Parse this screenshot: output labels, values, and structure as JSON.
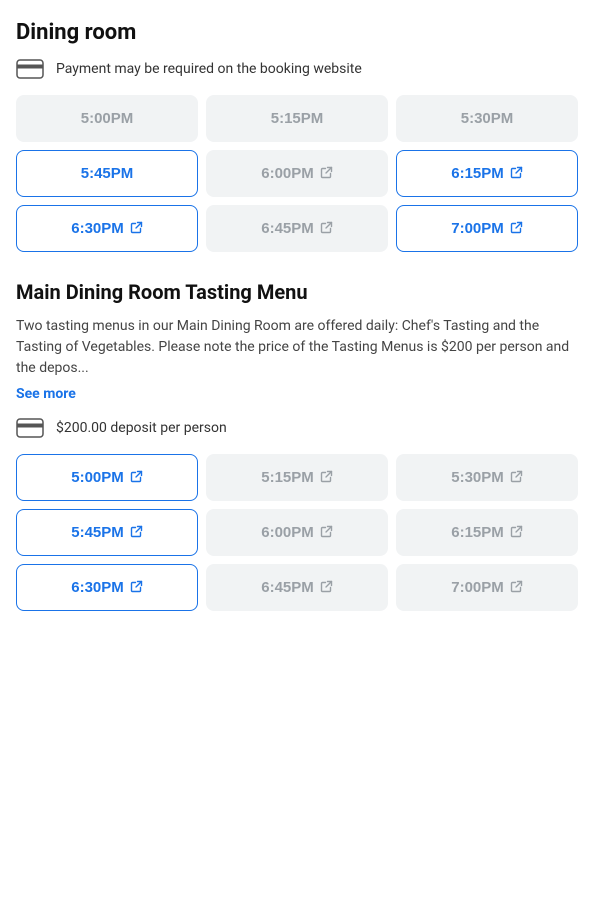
{
  "dining_room": {
    "title": "Dining room",
    "payment_notice": "Payment may be required on the booking website",
    "time_slots_row1": [
      {
        "time": "5:00PM",
        "state": "unavailable",
        "external": false
      },
      {
        "time": "5:15PM",
        "state": "unavailable",
        "external": false
      },
      {
        "time": "5:30PM",
        "state": "unavailable",
        "external": false
      }
    ],
    "time_slots_row2": [
      {
        "time": "5:45PM",
        "state": "active",
        "external": false
      },
      {
        "time": "6:00PM",
        "state": "external-gray",
        "external": true
      },
      {
        "time": "6:15PM",
        "state": "active-external",
        "external": true
      }
    ],
    "time_slots_row3": [
      {
        "time": "6:30PM",
        "state": "active-external",
        "external": true
      },
      {
        "time": "6:45PM",
        "state": "external-gray",
        "external": true
      },
      {
        "time": "7:00PM",
        "state": "active-external",
        "external": true
      }
    ]
  },
  "tasting_menu": {
    "title": "Main Dining Room Tasting Menu",
    "description": "Two tasting menus in our Main Dining Room are offered daily: Chef's Tasting and the Tasting of Vegetables. Please note the price of the Tasting Menus is $200 per person and the depos...",
    "see_more_label": "See more",
    "deposit_notice": "$200.00 deposit per person",
    "time_slots_row1": [
      {
        "time": "5:00PM",
        "state": "active-external",
        "external": true
      },
      {
        "time": "5:15PM",
        "state": "external-gray",
        "external": true
      },
      {
        "time": "5:30PM",
        "state": "external-gray",
        "external": true
      }
    ],
    "time_slots_row2": [
      {
        "time": "5:45PM",
        "state": "active-external",
        "external": true
      },
      {
        "time": "6:00PM",
        "state": "external-gray",
        "external": true
      },
      {
        "time": "6:15PM",
        "state": "external-gray",
        "external": true
      }
    ],
    "time_slots_row3": [
      {
        "time": "6:30PM",
        "state": "active-external",
        "external": true
      },
      {
        "time": "6:45PM",
        "state": "external-gray",
        "external": true
      },
      {
        "time": "7:00PM",
        "state": "external-gray",
        "external": true
      }
    ]
  },
  "icons": {
    "external_link": "⇗",
    "card_symbol": "▬"
  }
}
